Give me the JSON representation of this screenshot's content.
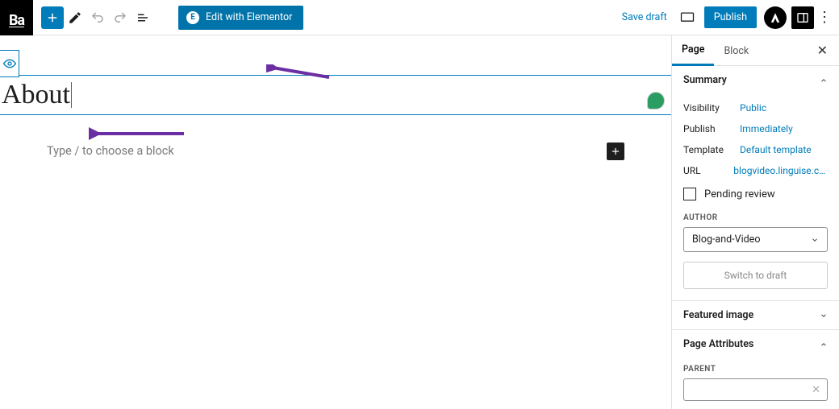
{
  "logo": "Ba",
  "toolbar": {
    "elementor_label": "Edit with Elementor",
    "save_draft": "Save draft",
    "publish": "Publish"
  },
  "editor": {
    "title": "About",
    "block_placeholder": "Type / to choose a block"
  },
  "sidebar": {
    "tabs": {
      "page": "Page",
      "block": "Block"
    },
    "summary": {
      "heading": "Summary",
      "visibility_k": "Visibility",
      "visibility_v": "Public",
      "publish_k": "Publish",
      "publish_v": "Immediately",
      "template_k": "Template",
      "template_v": "Default template",
      "url_k": "URL",
      "url_v": "blogvideo.linguise.com…",
      "pending_review": "Pending review",
      "author_label": "AUTHOR",
      "author_value": "Blog-and-Video",
      "switch_draft": "Switch to draft"
    },
    "featured_image": "Featured image",
    "page_attributes": "Page Attributes",
    "parent_label": "PARENT"
  }
}
